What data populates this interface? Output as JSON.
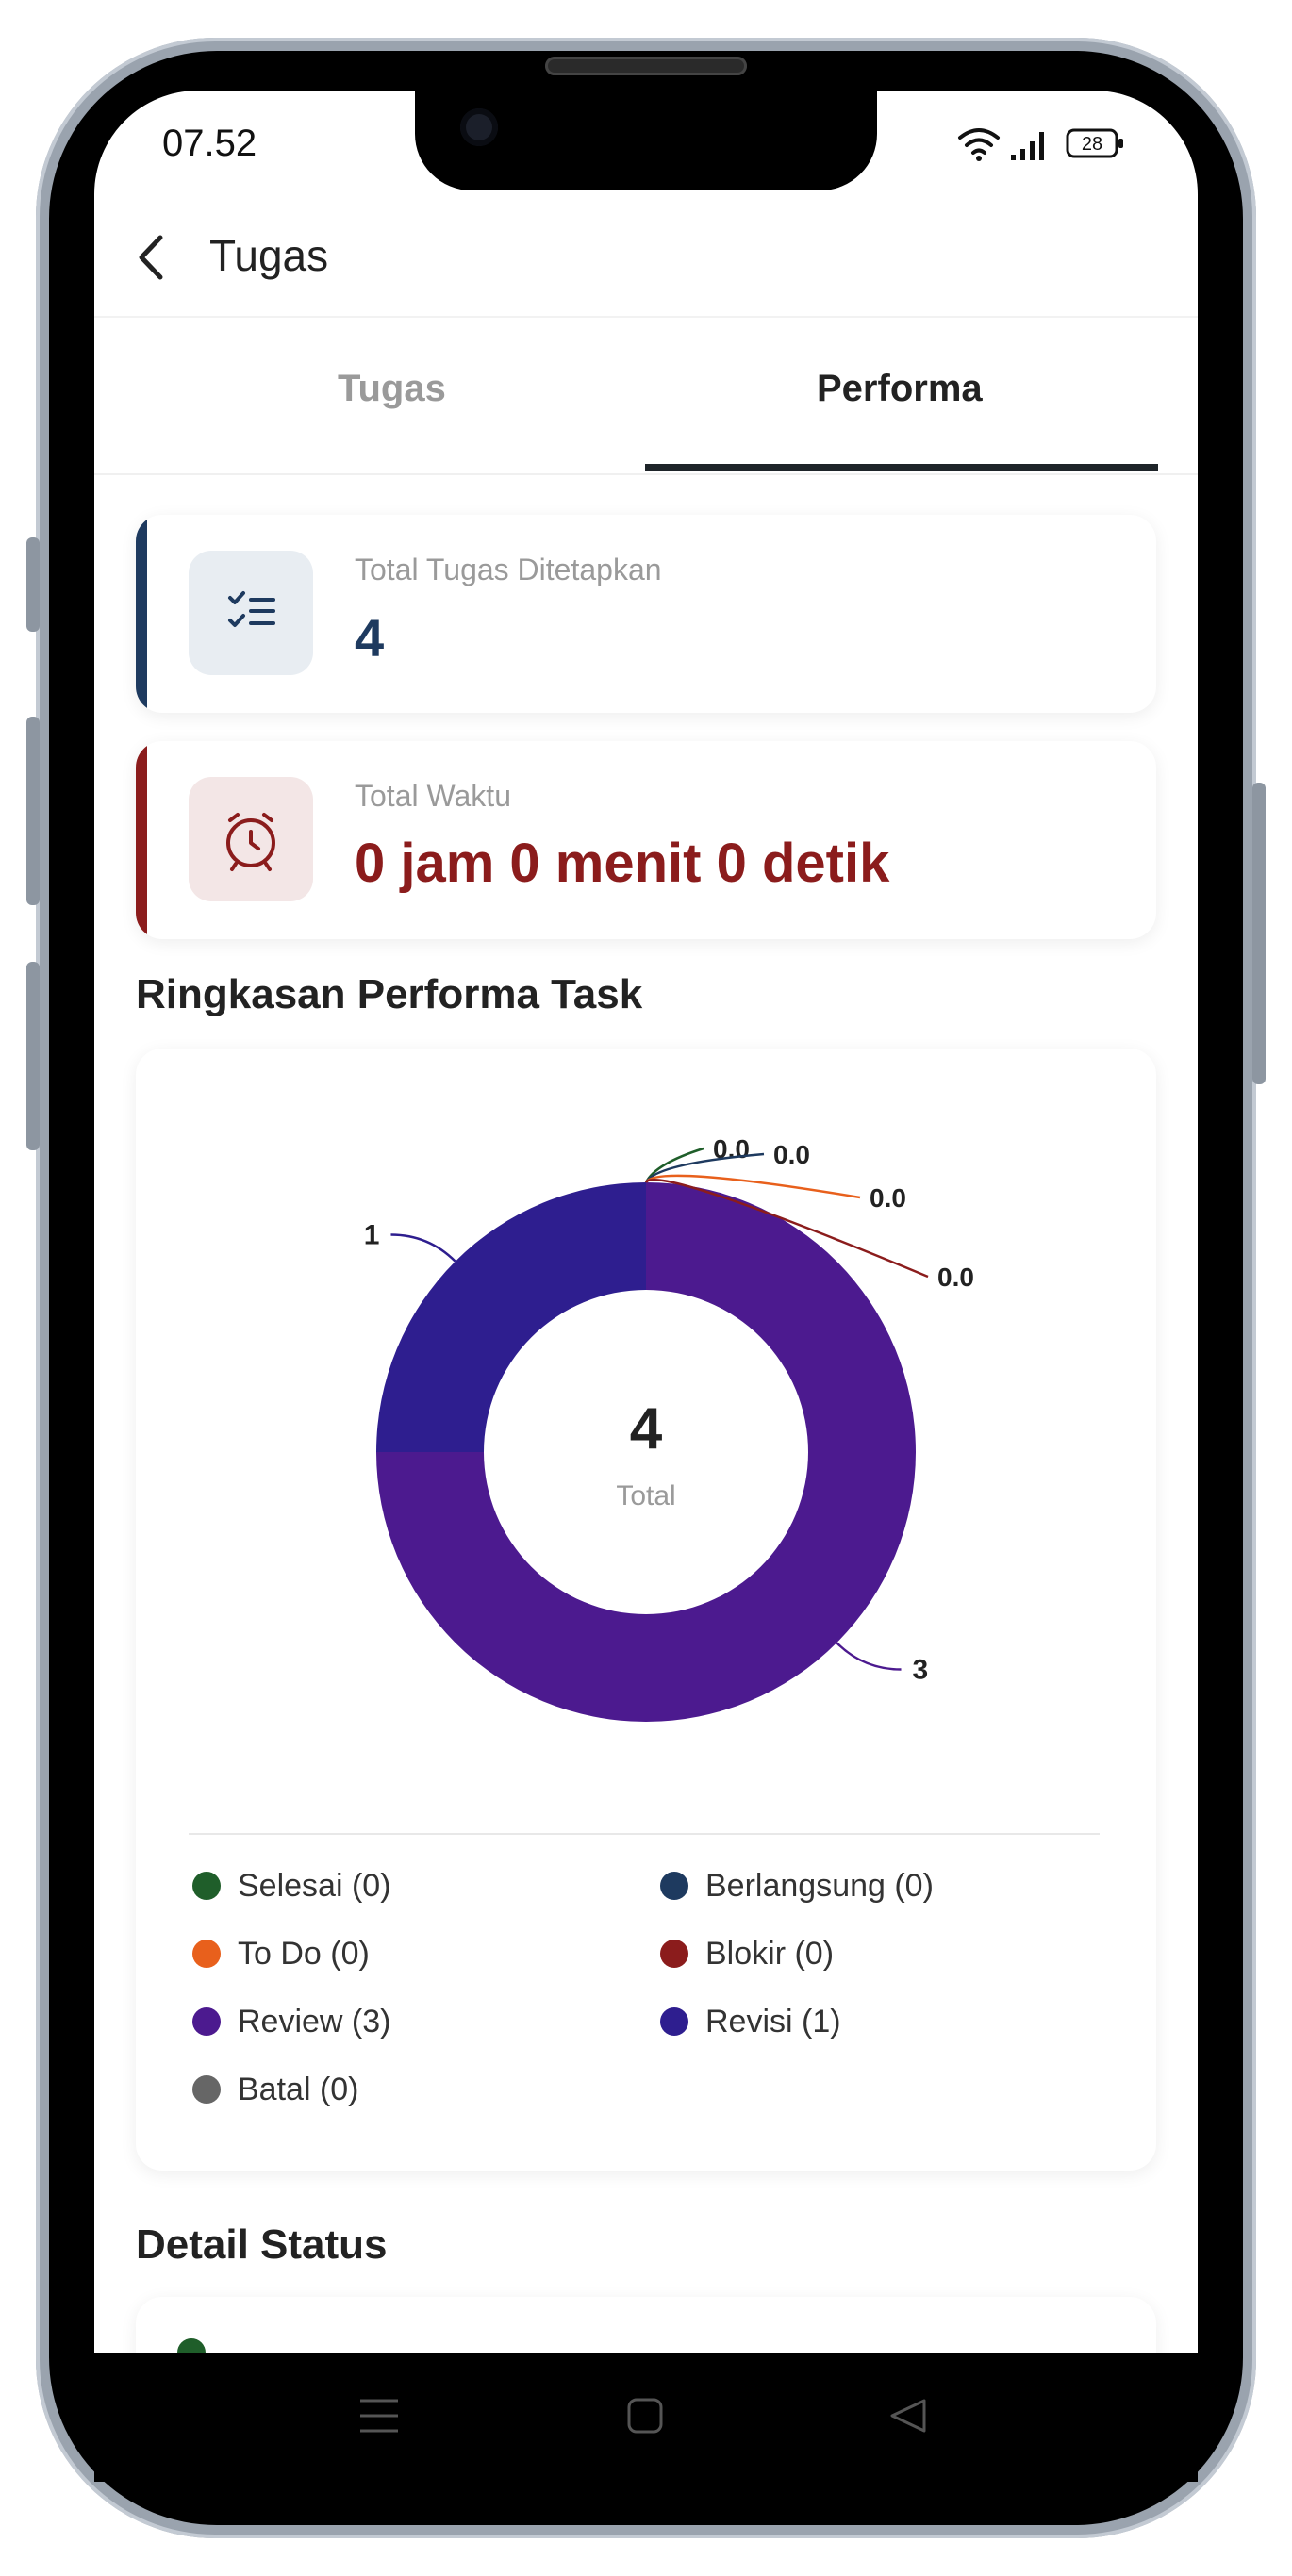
{
  "status_bar": {
    "time": "07.52",
    "battery": "28"
  },
  "header": {
    "title": "Tugas"
  },
  "tabs": [
    {
      "label": "Tugas",
      "active": false
    },
    {
      "label": "Performa",
      "active": true
    }
  ],
  "cards": {
    "total_tugas": {
      "label": "Total Tugas Ditetapkan",
      "value": "4",
      "accent": "#1e3a5f"
    },
    "total_waktu": {
      "label": "Total Waktu",
      "value": "0 jam 0 menit 0 detik",
      "accent": "#8b1c1c"
    }
  },
  "summary_section": {
    "title": "Ringkasan Performa Task"
  },
  "chart_data": {
    "type": "pie",
    "center_value": "4",
    "center_label": "Total",
    "slices": [
      {
        "name": "Selesai",
        "value": 0,
        "label": "0.0",
        "color": "#1f5e2a"
      },
      {
        "name": "Berlangsung",
        "value": 0,
        "label": "0.0",
        "color": "#1e3a5f"
      },
      {
        "name": "To Do",
        "value": 0,
        "label": "0.0",
        "color": "#e8601c"
      },
      {
        "name": "Blokir",
        "value": 0,
        "label": "0.0",
        "color": "#8b1c1c"
      },
      {
        "name": "Review",
        "value": 3,
        "label": "3",
        "color": "#4c1a8f"
      },
      {
        "name": "Revisi",
        "value": 1,
        "label": "1",
        "color": "#2e1e8f"
      },
      {
        "name": "Batal",
        "value": 0,
        "label": "",
        "color": "#666666"
      }
    ]
  },
  "legend": [
    {
      "label": "Selesai (0)",
      "color": "#1f5e2a"
    },
    {
      "label": "Berlangsung (0)",
      "color": "#1e3a5f"
    },
    {
      "label": "To Do (0)",
      "color": "#e8601c"
    },
    {
      "label": "Blokir (0)",
      "color": "#8b1c1c"
    },
    {
      "label": "Review (3)",
      "color": "#4c1a8f"
    },
    {
      "label": "Revisi (1)",
      "color": "#2e1e8f"
    },
    {
      "label": "Batal (0)",
      "color": "#666666"
    }
  ],
  "detail_section": {
    "title": "Detail Status"
  },
  "icons": {
    "back": "back-arrow-icon",
    "tasks": "checklist-icon",
    "time": "alarm-clock-icon",
    "nav_menu": "menu-icon",
    "nav_home": "home-square-icon",
    "nav_back": "back-triangle-icon"
  }
}
